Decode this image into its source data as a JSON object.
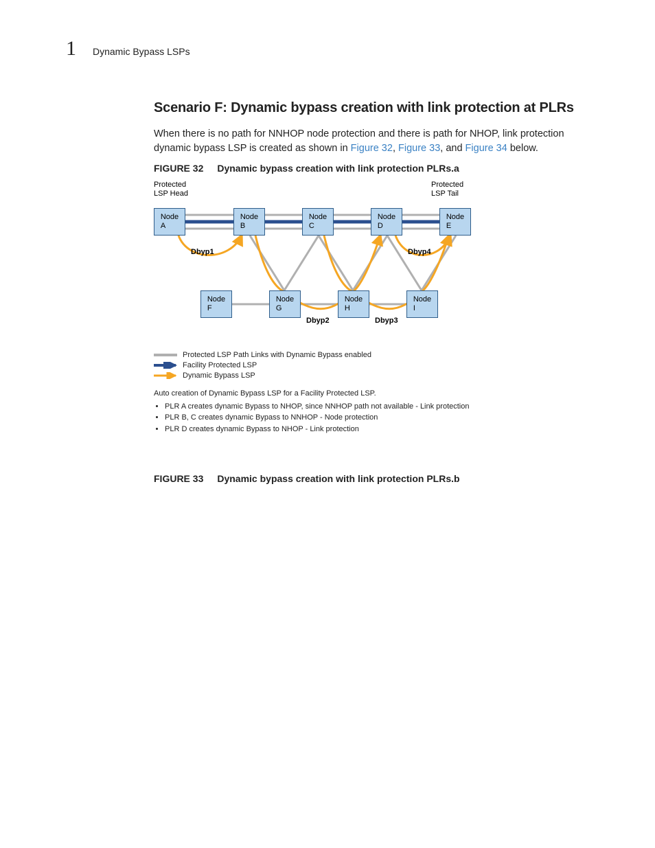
{
  "header": {
    "chapter": "1",
    "breadcrumb": "Dynamic Bypass LSPs"
  },
  "section": {
    "title": "Scenario F: Dynamic bypass creation with link protection at PLRs",
    "para_pre": "When there is no path for NNHOP node protection and there is path for NHOP, link protection dynamic bypass LSP is created as shown in ",
    "link32": "Figure 32",
    "sep1": ", ",
    "link33": "Figure 33",
    "sep2": ", and ",
    "link34": "Figure 34",
    "para_post": " below."
  },
  "figure32": {
    "label": "FIGURE 32",
    "title": "Dynamic bypass creation with link protection PLRs.a",
    "head_label": "Protected\nLSP Head",
    "tail_label": "Protected\nLSP Tail",
    "nodes": {
      "A": "Node\nA",
      "B": "Node\nB",
      "C": "Node\nC",
      "D": "Node\nD",
      "E": "Node\nE",
      "F": "Node\nF",
      "G": "Node\nG",
      "H": "Node\nH",
      "I": "Node\nI"
    },
    "dbyp": {
      "d1": "Dbyp1",
      "d2": "Dbyp2",
      "d3": "Dbyp3",
      "d4": "Dbyp4"
    }
  },
  "legend": {
    "l1": "Protected LSP Path Links with Dynamic Bypass enabled",
    "l2": "Facility Protected LSP",
    "l3": "Dynamic Bypass LSP"
  },
  "notes": {
    "title": "Auto creation of Dynamic Bypass LSP for a Facility Protected LSP.",
    "b1": "PLR A creates dynamic Bypass to NHOP, since NNHOP path not available - Link protection",
    "b2": "PLR B, C creates dynamic Bypass to NNHOP - Node protection",
    "b3": "PLR D creates dynamic Bypass to NHOP - Link protection"
  },
  "figure33": {
    "label": "FIGURE 33",
    "title": "Dynamic bypass creation with link protection PLRs.b"
  }
}
